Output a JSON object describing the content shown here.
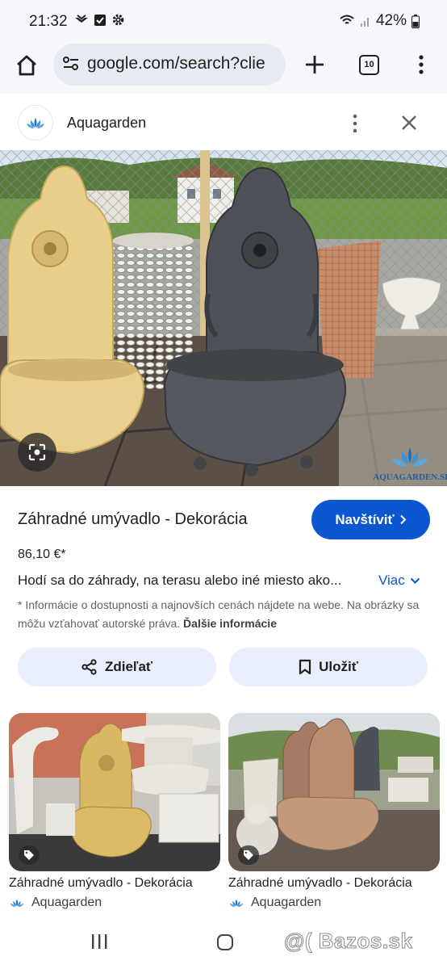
{
  "status_bar": {
    "time": "21:32",
    "battery": "42%",
    "icons": [
      "bird-icon",
      "check-box-icon",
      "settings-gear-icon",
      "wifi-icon",
      "signal-icon",
      "battery-icon"
    ]
  },
  "browser": {
    "url": "google.com/search?clie",
    "tab_count": "10"
  },
  "source": {
    "name": "Aquagarden"
  },
  "main_image": {
    "watermark": "AQUAGARDEN.SK"
  },
  "product": {
    "title": "Záhradné umývadlo - Dekorácia",
    "visit_label": "Navštíviť",
    "price": "86,10 €*",
    "description": "Hodí sa do záhrady, na terasu alebo iné miesto ako...",
    "more_label": "Viac",
    "disclaimer": "* Informácie o dostupnosti a najnovších cenách nájdete na webe. Na obrázky sa môžu vzťahovať autorské práva.",
    "disclaimer_link": "Ďalšie informácie"
  },
  "actions": {
    "share_label": "Zdieľať",
    "save_label": "Uložiť"
  },
  "related": [
    {
      "title": "Záhradné umývadlo - Dekorácia",
      "source": "Aquagarden"
    },
    {
      "title": "Záhradné umývadlo - Dekorácia",
      "source": "Aquagarden"
    }
  ],
  "nav_bar": {
    "watermark_text": "@( Bazos.sk"
  },
  "colors": {
    "accent": "#0b57d0",
    "action_bg": "#e8eefb",
    "url_bg": "#e6ebf3",
    "chrome_bg": "#f6f8fc"
  }
}
